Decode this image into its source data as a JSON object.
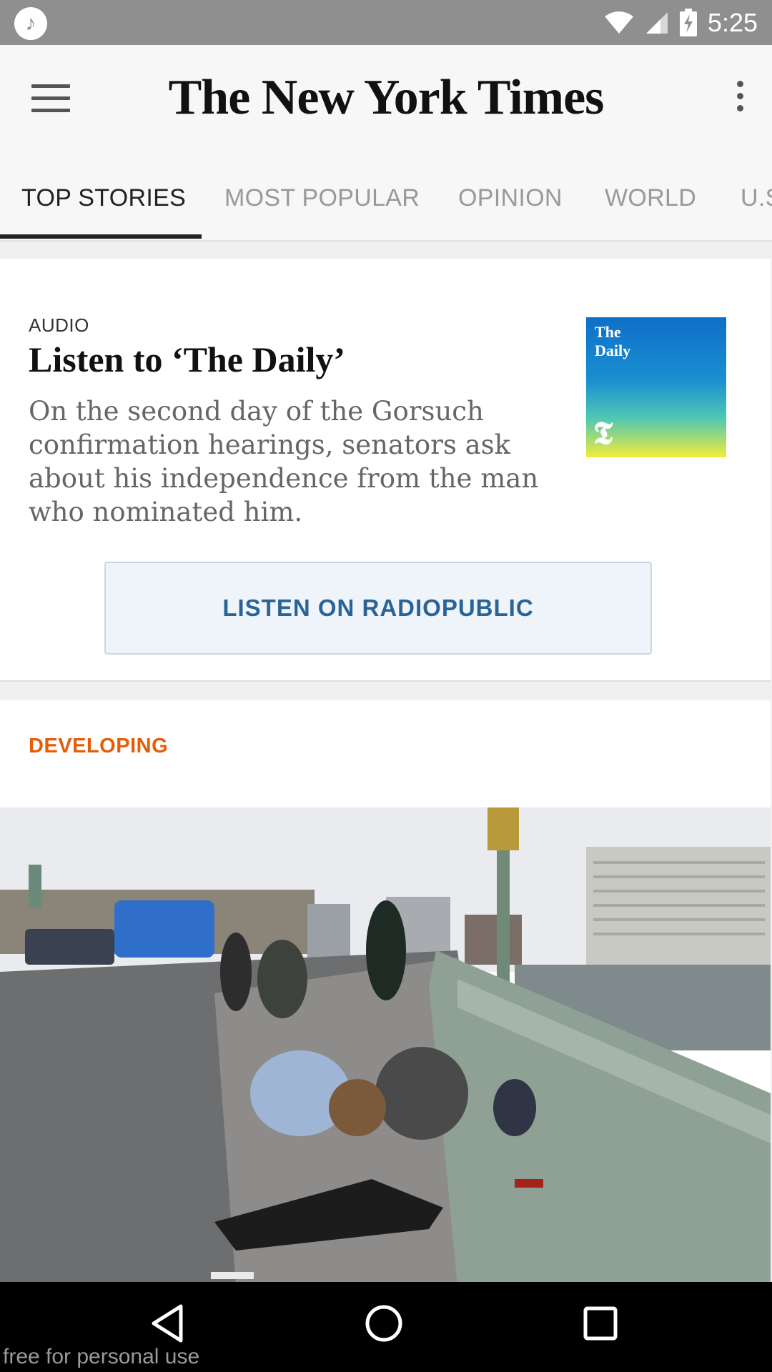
{
  "status_bar": {
    "time": "5:25",
    "icons": [
      "app-notification-icon",
      "wifi-icon",
      "cell-signal-icon",
      "battery-charging-icon"
    ]
  },
  "app_bar": {
    "brand": "The New York Times",
    "menu_icon": "hamburger-menu-icon",
    "overflow_icon": "more-vert-icon"
  },
  "tabs": [
    {
      "label": "TOP STORIES",
      "active": true
    },
    {
      "label": "MOST POPULAR",
      "active": false
    },
    {
      "label": "OPINION",
      "active": false
    },
    {
      "label": "WORLD",
      "active": false
    },
    {
      "label": "U.S.",
      "active": false
    }
  ],
  "audio_card": {
    "kicker": "AUDIO",
    "headline": "Listen to ‘The Daily’",
    "summary": "On the second day of the Gorsuch confirmation hearings, senators ask about his independence from the man who nominated him.",
    "thumbnail_title": "The\nDaily",
    "thumbnail_logo": "𝕿",
    "button_label": "LISTEN ON RADIOPUBLIC"
  },
  "developing_card": {
    "label": "DEVELOPING"
  },
  "watermark": "free for personal use",
  "colors": {
    "status_bar": "#8f8f8f",
    "developing": "#e35d0a",
    "button_text": "#2a6496"
  }
}
